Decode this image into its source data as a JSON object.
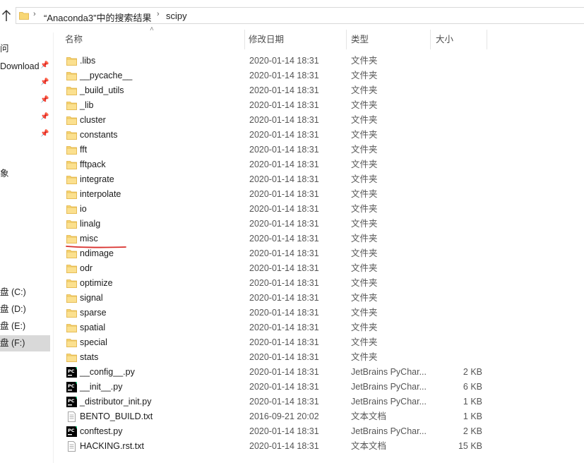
{
  "address": {
    "crumbs": [
      "“Anaconda3”中的搜索结果",
      "scipy"
    ]
  },
  "nav": {
    "items": [
      {
        "label": "问",
        "pinned": false
      },
      {
        "label": "Download",
        "pinned": true
      },
      {
        "label": "",
        "pinned": true
      },
      {
        "label": "",
        "pinned": true
      },
      {
        "label": "",
        "pinned": true
      },
      {
        "label": "",
        "pinned": true
      },
      {
        "label": "象",
        "pinned": false
      },
      {
        "label": "盘 (C:)",
        "pinned": false
      },
      {
        "label": "盘 (D:)",
        "pinned": false
      },
      {
        "label": "盘 (E:)",
        "pinned": false
      },
      {
        "label": "盘 (F:)",
        "pinned": false
      }
    ]
  },
  "columns": {
    "name": "名称",
    "date": "修改日期",
    "type": "类型",
    "size": "大小"
  },
  "files": [
    {
      "name": ".libs",
      "date": "2020-01-14 18:31",
      "type": "文件夹",
      "size": "",
      "kind": "folder"
    },
    {
      "name": "__pycache__",
      "date": "2020-01-14 18:31",
      "type": "文件夹",
      "size": "",
      "kind": "folder"
    },
    {
      "name": "_build_utils",
      "date": "2020-01-14 18:31",
      "type": "文件夹",
      "size": "",
      "kind": "folder"
    },
    {
      "name": "_lib",
      "date": "2020-01-14 18:31",
      "type": "文件夹",
      "size": "",
      "kind": "folder"
    },
    {
      "name": "cluster",
      "date": "2020-01-14 18:31",
      "type": "文件夹",
      "size": "",
      "kind": "folder"
    },
    {
      "name": "constants",
      "date": "2020-01-14 18:31",
      "type": "文件夹",
      "size": "",
      "kind": "folder"
    },
    {
      "name": "fft",
      "date": "2020-01-14 18:31",
      "type": "文件夹",
      "size": "",
      "kind": "folder"
    },
    {
      "name": "fftpack",
      "date": "2020-01-14 18:31",
      "type": "文件夹",
      "size": "",
      "kind": "folder"
    },
    {
      "name": "integrate",
      "date": "2020-01-14 18:31",
      "type": "文件夹",
      "size": "",
      "kind": "folder"
    },
    {
      "name": "interpolate",
      "date": "2020-01-14 18:31",
      "type": "文件夹",
      "size": "",
      "kind": "folder"
    },
    {
      "name": "io",
      "date": "2020-01-14 18:31",
      "type": "文件夹",
      "size": "",
      "kind": "folder"
    },
    {
      "name": "linalg",
      "date": "2020-01-14 18:31",
      "type": "文件夹",
      "size": "",
      "kind": "folder"
    },
    {
      "name": "misc",
      "date": "2020-01-14 18:31",
      "type": "文件夹",
      "size": "",
      "kind": "folder"
    },
    {
      "name": "ndimage",
      "date": "2020-01-14 18:31",
      "type": "文件夹",
      "size": "",
      "kind": "folder"
    },
    {
      "name": "odr",
      "date": "2020-01-14 18:31",
      "type": "文件夹",
      "size": "",
      "kind": "folder"
    },
    {
      "name": "optimize",
      "date": "2020-01-14 18:31",
      "type": "文件夹",
      "size": "",
      "kind": "folder"
    },
    {
      "name": "signal",
      "date": "2020-01-14 18:31",
      "type": "文件夹",
      "size": "",
      "kind": "folder"
    },
    {
      "name": "sparse",
      "date": "2020-01-14 18:31",
      "type": "文件夹",
      "size": "",
      "kind": "folder"
    },
    {
      "name": "spatial",
      "date": "2020-01-14 18:31",
      "type": "文件夹",
      "size": "",
      "kind": "folder"
    },
    {
      "name": "special",
      "date": "2020-01-14 18:31",
      "type": "文件夹",
      "size": "",
      "kind": "folder"
    },
    {
      "name": "stats",
      "date": "2020-01-14 18:31",
      "type": "文件夹",
      "size": "",
      "kind": "folder"
    },
    {
      "name": "__config__.py",
      "date": "2020-01-14 18:31",
      "type": "JetBrains PyChar...",
      "size": "2 KB",
      "kind": "py"
    },
    {
      "name": "__init__.py",
      "date": "2020-01-14 18:31",
      "type": "JetBrains PyChar...",
      "size": "6 KB",
      "kind": "py"
    },
    {
      "name": "_distributor_init.py",
      "date": "2020-01-14 18:31",
      "type": "JetBrains PyChar...",
      "size": "1 KB",
      "kind": "py"
    },
    {
      "name": "BENTO_BUILD.txt",
      "date": "2016-09-21 20:02",
      "type": "文本文档",
      "size": "1 KB",
      "kind": "txt"
    },
    {
      "name": "conftest.py",
      "date": "2020-01-14 18:31",
      "type": "JetBrains PyChar...",
      "size": "2 KB",
      "kind": "py"
    },
    {
      "name": "HACKING.rst.txt",
      "date": "2020-01-14 18:31",
      "type": "文本文档",
      "size": "15 KB",
      "kind": "txt"
    }
  ],
  "colors": {
    "folder": "#f8d775",
    "folder_dark": "#e8b84a",
    "py_icon_bg": "#000000",
    "py_icon_accent": "#21d789",
    "underline_mark": "#d9302c"
  }
}
